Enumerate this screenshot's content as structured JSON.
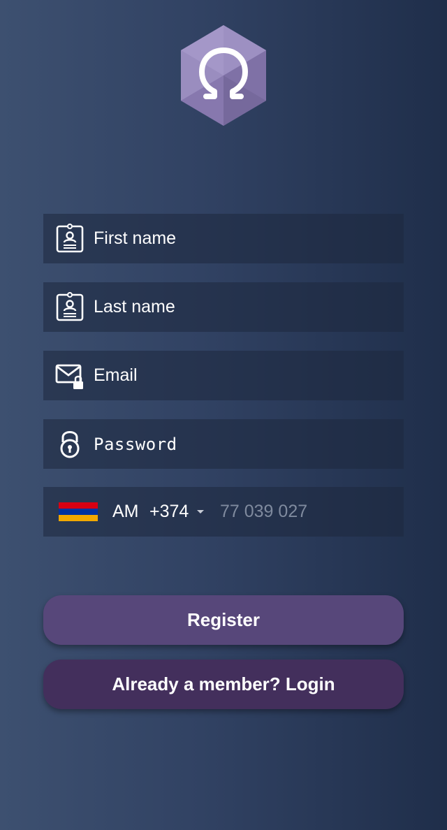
{
  "logo": {
    "icon": "omega-hexagon-logo",
    "color": "#8e80b5"
  },
  "form": {
    "first_name": {
      "placeholder": "First name",
      "icon": "id-badge-icon"
    },
    "last_name": {
      "placeholder": "Last name",
      "icon": "id-badge-icon"
    },
    "email": {
      "placeholder": "Email",
      "icon": "email-lock-icon"
    },
    "password": {
      "placeholder": "Password",
      "icon": "padlock-icon"
    },
    "phone": {
      "flag": "armenia-flag",
      "flag_colors": [
        "#d90012",
        "#0033a0",
        "#f2a800"
      ],
      "country_code": "AM",
      "dial_code": "+374",
      "placeholder": "77 039 027"
    }
  },
  "buttons": {
    "register_label": "Register",
    "login_label": "Already a member? Login",
    "register_color": "#57477a",
    "login_color": "#432f5c"
  }
}
